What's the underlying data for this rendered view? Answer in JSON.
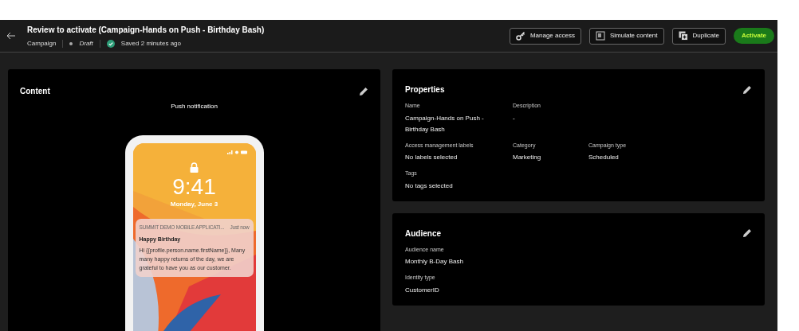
{
  "header": {
    "title": "Review to activate (Campaign-Hands on Push - Birthday Bash)",
    "type": "Campaign",
    "status": "Draft",
    "saved": "Saved 2 minutes ago"
  },
  "actions": [
    {
      "label": "Manage access",
      "kind": "key"
    },
    {
      "label": "Simulate content",
      "kind": "simulate"
    },
    {
      "label": "Duplicate",
      "kind": "duplicate"
    },
    {
      "label": "Activate",
      "kind": "primary"
    }
  ],
  "content": {
    "title": "Content",
    "subtitle": "Push notification",
    "phone": {
      "time": "9:41",
      "date": "Monday, June 3",
      "notification": {
        "app": "SUMMIT DEMO MOBILE APPLICATI...",
        "when": "Just now",
        "title": "Happy Birthday",
        "body": "Hi {{profile.person.name.firstName}}, Many many happy returns of the day, we are grateful to have you as our customer."
      }
    }
  },
  "properties": {
    "title": "Properties",
    "rows": [
      [
        {
          "label": "Name",
          "value": "Campaign-Hands on Push - Birthday Bash"
        },
        {
          "label": "Description",
          "value": "-"
        }
      ],
      [
        {
          "label": "Access management labels",
          "value": "No labels selected"
        },
        {
          "label": "Category",
          "value": "Marketing"
        },
        {
          "label": "Campaign type",
          "value": "Scheduled"
        }
      ],
      [
        {
          "label": "Tags",
          "value": "No tags selected"
        }
      ]
    ]
  },
  "audience": {
    "title": "Audience",
    "rows": [
      [
        {
          "label": "Audience name",
          "value": "Monthly B-Day Bash"
        }
      ],
      [
        {
          "label": "Identity type",
          "value": "CustomerID"
        }
      ]
    ]
  }
}
